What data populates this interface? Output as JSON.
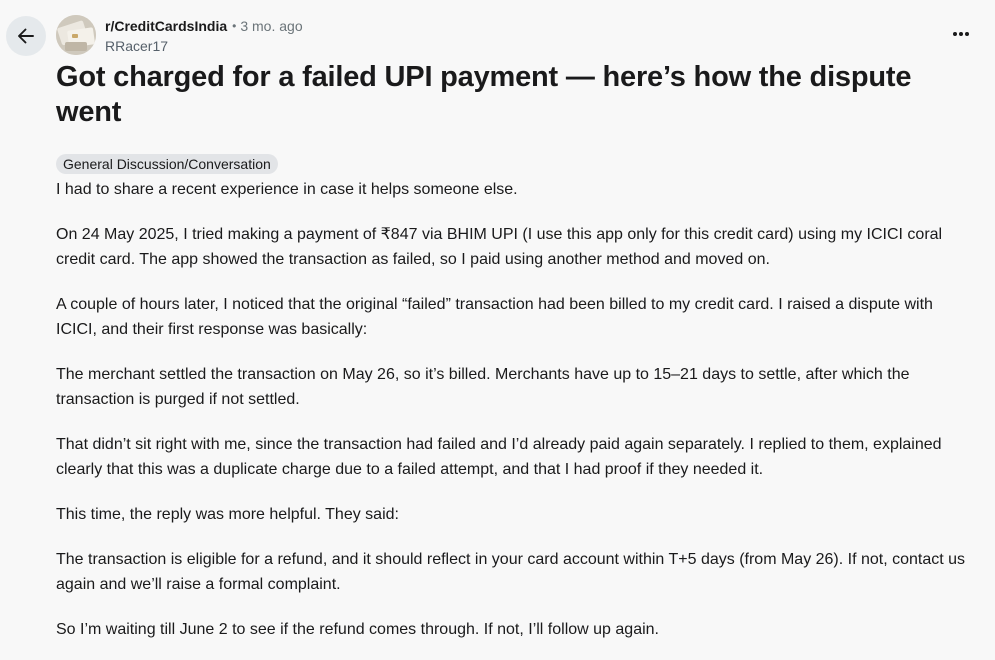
{
  "post": {
    "subreddit": "r/CreditCardsIndia",
    "separator": "•",
    "time_ago": "3 mo. ago",
    "author": "RRacer17",
    "title": "Got charged for a failed UPI payment — here’s how the dispute went",
    "flair": "General Discussion/Conversation",
    "paragraphs": [
      "I had to share a recent experience in case it helps someone else.",
      "On 24 May 2025, I tried making a payment of ₹847 via BHIM UPI (I use this app only for this credit card) using my ICICI coral credit card. The app showed the transaction as failed, so I paid using another method and moved on.",
      "A couple of hours later, I noticed that the original “failed” transaction had been billed to my credit card. I raised a dispute with ICICI, and their first response was basically:",
      "The merchant settled the transaction on May 26, so it’s billed. Merchants have up to 15–21 days to settle, after which the transaction is purged if not settled.",
      "That didn’t sit right with me, since the transaction had failed and I’d already paid again separately. I replied to them, explained clearly that this was a duplicate charge due to a failed attempt, and that I had proof if they needed it.",
      "This time, the reply was more helpful. They said:",
      "The transaction is eligible for a refund, and it should reflect in your card account within T+5 days (from May 26). If not, contact us again and we’ll raise a formal complaint.",
      "So I’m waiting till June 2 to see if the refund comes through. If not, I’ll follow up again."
    ]
  },
  "icons": {
    "back": "arrow-left-icon",
    "more": "more-horizontal-icon",
    "avatar": "subreddit-avatar"
  },
  "colors": {
    "background": "#f8f8f8",
    "back_button_bg": "#e5e9ec",
    "flair_bg": "#e2e4e7",
    "text_primary": "#1a1a1b",
    "text_muted": "#6b7479"
  }
}
